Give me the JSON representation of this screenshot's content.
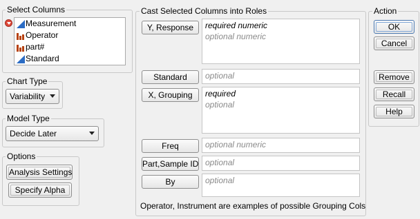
{
  "select_columns": {
    "title": "Select Columns",
    "columns": [
      {
        "name": "Measurement",
        "icon": "continuous-icon"
      },
      {
        "name": "Operator",
        "icon": "nominal-icon"
      },
      {
        "name": "part#",
        "icon": "nominal-icon"
      },
      {
        "name": "Standard",
        "icon": "continuous-icon"
      }
    ]
  },
  "chart_type": {
    "title": "Chart Type",
    "selected": "Variability"
  },
  "model_type": {
    "title": "Model Type",
    "selected": "Decide Later"
  },
  "options": {
    "title": "Options",
    "analysis_settings": "Analysis Settings",
    "specify_alpha": "Specify Alpha"
  },
  "cast": {
    "title": "Cast Selected Columns into Roles",
    "roles": {
      "y_response": {
        "label": "Y, Response",
        "line1": "required numeric",
        "line2": "optional numeric"
      },
      "standard": {
        "label": "Standard",
        "placeholder": "optional"
      },
      "x_grouping": {
        "label": "X, Grouping",
        "line1": "required",
        "line2": "optional"
      },
      "freq": {
        "label": "Freq",
        "placeholder": "optional numeric"
      },
      "part_sample_id": {
        "label": "Part,Sample ID",
        "placeholder": "optional"
      },
      "by": {
        "label": "By",
        "placeholder": "optional"
      }
    },
    "note": "Operator, Instrument are examples of possible Grouping Cols"
  },
  "action": {
    "title": "Action",
    "ok": "OK",
    "cancel": "Cancel",
    "remove": "Remove",
    "recall": "Recall",
    "help": "Help"
  },
  "colors": {
    "continuous": "#2b6cc4",
    "nominal": "#b7410e",
    "disclosure": "#c0392b"
  }
}
